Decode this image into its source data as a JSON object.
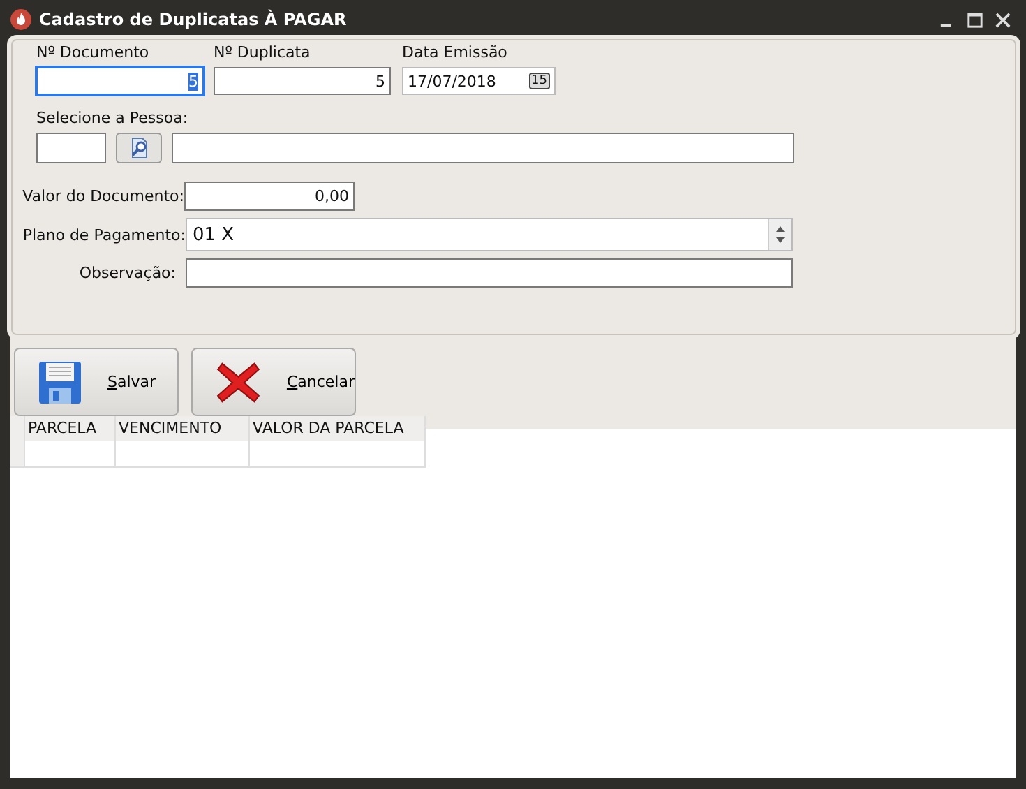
{
  "window": {
    "title": "Cadastro de Duplicatas À PAGAR"
  },
  "fields_top": [
    {
      "label": "Nº Documento",
      "value": "5",
      "focused": true,
      "kind": "text"
    },
    {
      "label": "Nº Duplicata",
      "value": "5",
      "focused": false,
      "kind": "text"
    },
    {
      "label": "Data Emissão",
      "value": "17/07/2018",
      "kind": "date",
      "calendar_glyph": "15"
    }
  ],
  "pessoa": {
    "label": "Selecione a Pessoa:"
  },
  "form": [
    {
      "label": "Valor do Documento:",
      "value": "0,00",
      "kind": "number"
    },
    {
      "label": "Plano de Pagamento:",
      "value": "01 X",
      "kind": "combo"
    },
    {
      "label": "Observação:",
      "kind": "text"
    }
  ],
  "buttons": [
    {
      "label": "Salvar",
      "kind": "save"
    },
    {
      "label": "Cancelar",
      "kind": "cancel"
    }
  ],
  "table": {
    "columns": [
      "PARCELA",
      "VENCIMENTO",
      "VALOR DA PARCELA"
    ]
  }
}
